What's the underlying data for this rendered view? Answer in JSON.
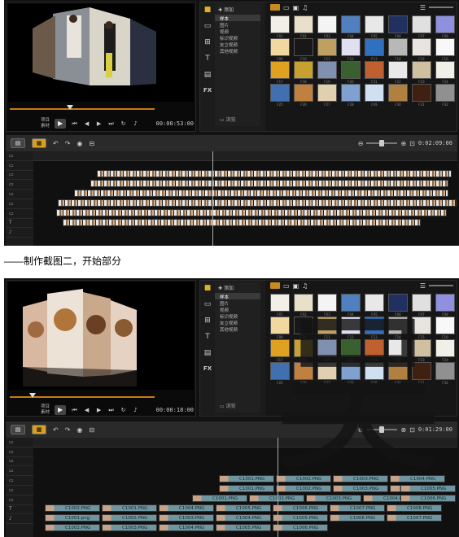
{
  "caption": "——制作截图二，开始部分",
  "watermark_text": "吴",
  "screenshots": [
    {
      "id": "s1",
      "library": {
        "add_label": "添加",
        "categories": [
          "样本",
          "图片",
          "视频",
          "标识视频",
          "友立视频",
          "其他视频"
        ],
        "browse_label": "浏览",
        "thumb_labels": [
          "F01",
          "F02",
          "F03",
          "F04",
          "F05",
          "F06",
          "F07",
          "F08",
          "F09",
          "F10",
          "F11",
          "F12",
          "F13",
          "F14",
          "F15",
          "F16",
          "F17",
          "F18",
          "F19",
          "F20",
          "F21",
          "F22",
          "F23",
          "F24",
          "F25",
          "F26",
          "F27",
          "F28",
          "F29",
          "F30",
          "F31",
          "F32"
        ]
      },
      "transport": {
        "project_label": "项目",
        "clip_label": "素材",
        "timecode": "00:00:53:00"
      },
      "timeline": {
        "end_timecode": "0:02:09:00"
      }
    },
    {
      "id": "s2",
      "library": {
        "add_label": "添加",
        "categories": [
          "样本",
          "图片",
          "视频",
          "标识视频",
          "友立视频",
          "其他视频"
        ],
        "browse_label": "浏览",
        "thumb_labels": [
          "F01",
          "F02",
          "F03",
          "F04",
          "F05",
          "F06",
          "F07",
          "F08",
          "F09",
          "F10",
          "F11",
          "F12",
          "F13",
          "F14",
          "F15",
          "F16",
          "F17",
          "F18",
          "F19",
          "F20",
          "F21",
          "F22",
          "F23",
          "F24",
          "F25",
          "F26",
          "F27",
          "F28",
          "F29",
          "F30",
          "F31",
          "F32"
        ]
      },
      "transport": {
        "project_label": "项目",
        "clip_label": "素材",
        "timecode": "00:00:18:00"
      },
      "timeline": {
        "end_timecode": "0:01:29:00"
      },
      "track_rows": [
        [
          {
            "label": "C1001.PNG"
          },
          {
            "label": "C1002.PNG"
          },
          {
            "label": "C1003.PNG"
          },
          {
            "label": "C1004.PNG"
          }
        ],
        [
          {
            "label": "C1001.PNG"
          },
          {
            "label": "C1002.PNG"
          },
          {
            "label": "C1003.PNG"
          },
          {
            "label": "C1004.PNG"
          },
          {
            "label": "C1005.PNG"
          }
        ],
        [
          {
            "label": "C1001.PNG"
          },
          {
            "label": "C1002.PNG"
          },
          {
            "label": "C1003.PNG"
          },
          {
            "label": "C1004.PNG"
          },
          {
            "label": "C1005.PNG"
          },
          {
            "label": "C1006.PNG"
          }
        ],
        [
          {
            "label": "C1002.PNG"
          },
          {
            "label": "C1001.PNG"
          },
          {
            "label": "C1004.PNG"
          },
          {
            "label": "C1005.PNG"
          },
          {
            "label": "C1006.PNG"
          },
          {
            "label": "C1007.PNG"
          },
          {
            "label": "C1008.PNG"
          }
        ],
        [
          {
            "label": "C1001.png"
          },
          {
            "label": "C1002.PNG"
          },
          {
            "label": "C1003.PNG"
          },
          {
            "label": "C1004.PNG"
          },
          {
            "label": "C1005.PNG"
          },
          {
            "label": "C1006.PNG"
          },
          {
            "label": "C1007.PNG"
          }
        ],
        [
          {
            "label": "C1002.PNG"
          },
          {
            "label": "C1003.PNG"
          },
          {
            "label": "C1004.PNG"
          },
          {
            "label": "C1005.PNG"
          },
          {
            "label": "C1006.PNG"
          }
        ]
      ]
    }
  ],
  "colors": {
    "accent": "#d8a020",
    "scrubber": "#c97a10",
    "clip_blue": "#6f96a0"
  }
}
